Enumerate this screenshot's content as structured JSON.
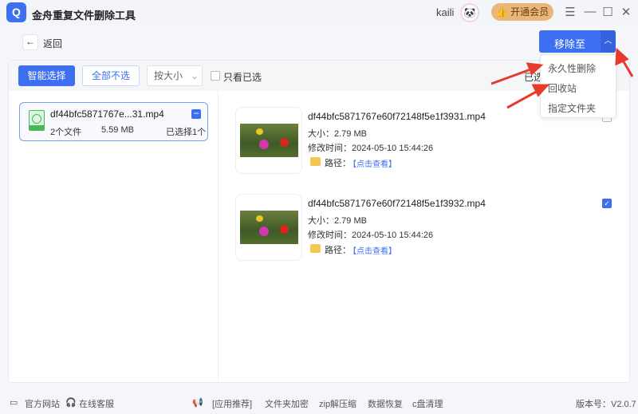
{
  "app": {
    "title": "金舟重复文件删除工具",
    "user": "kaili",
    "vip": "开通会员"
  },
  "nav": {
    "back": "返回"
  },
  "actions": {
    "remove_to": "移除至",
    "menu": [
      "永久性删除",
      "回收站",
      "指定文件夹"
    ]
  },
  "toolbar": {
    "smart_select": "智能选择",
    "deselect_all": "全部不选",
    "sort": "按大小",
    "only_selected": "只看已选",
    "selected_label": "已选"
  },
  "groups": [
    {
      "name": "df44bfc5871767e...31.mp4",
      "count": "2个文件",
      "size": "5.59 MB",
      "selected": "已选择1个"
    }
  ],
  "files": [
    {
      "name": "df44bfc5871767e60f72148f5e1f3931.mp4",
      "size": "大小：2.79 MB",
      "modified": "修改时间：2024-05-10 15:44:26",
      "path_label": "路径：",
      "path_link": "【点击查看】",
      "checked": false
    },
    {
      "name": "df44bfc5871767e60f72148f5e1f3932.mp4",
      "size": "大小：2.79 MB",
      "modified": "修改时间：2024-05-10 15:44:26",
      "path_label": "路径：",
      "path_link": "【点击查看】",
      "checked": true
    }
  ],
  "footer": {
    "website": "官方网站",
    "support": "在线客服",
    "recommend": "[应用推荐]",
    "links": [
      "文件夹加密",
      "zip解压缩",
      "数据恢复",
      "c盘清理"
    ],
    "version": "版本号：V2.0.7"
  },
  "colors": {
    "accent": "#3d6ff0",
    "vip": "#e9b77a",
    "arrow": "#e8392e"
  }
}
